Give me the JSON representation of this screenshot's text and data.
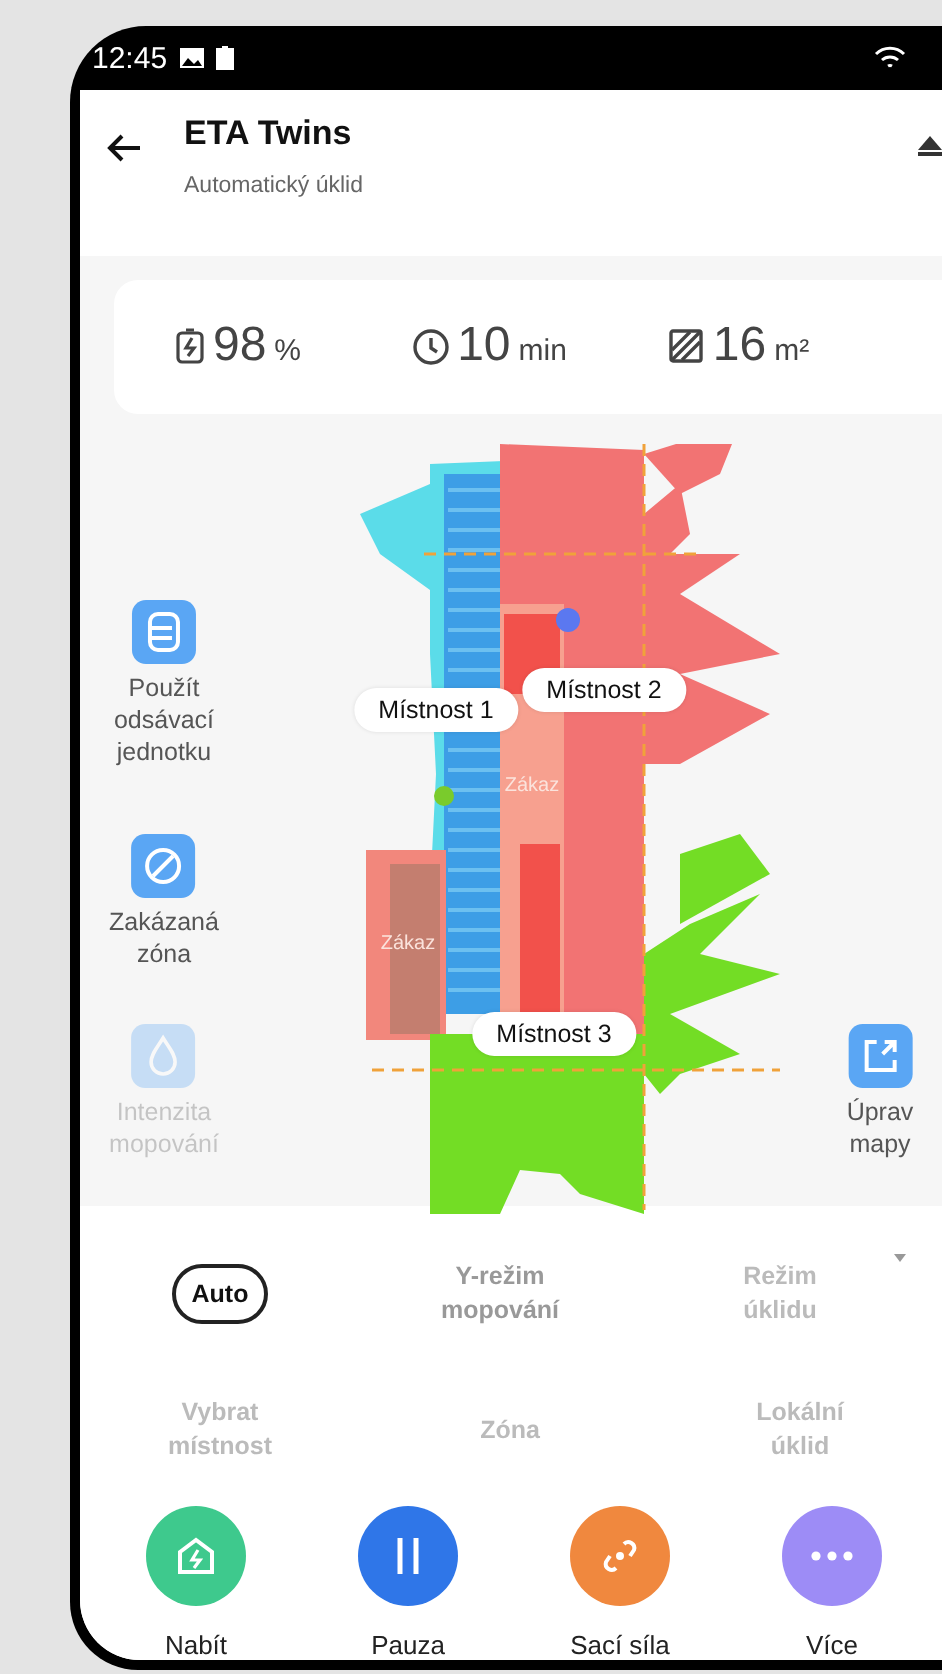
{
  "status_bar": {
    "time": "12:45"
  },
  "header": {
    "title": "ETA Twins",
    "subtitle": "Automatický úklid"
  },
  "stats": [
    {
      "kind": "battery",
      "value": "98",
      "unit": "%"
    },
    {
      "kind": "time",
      "value": "10",
      "unit": "min"
    },
    {
      "kind": "area",
      "value": "16",
      "unit": "m²"
    }
  ],
  "map": {
    "rooms": [
      {
        "label": "Místnost 1"
      },
      {
        "label": "Místnost 2"
      },
      {
        "label": "Místnost 3"
      }
    ],
    "zones": [
      {
        "label": "Zákaz"
      },
      {
        "label": "Zákaz"
      }
    ]
  },
  "side_tools": [
    {
      "kind": "station",
      "label": "Použít\nodsávací\njednotku",
      "disabled": false
    },
    {
      "kind": "nogo",
      "label": "Zakázaná\nzóna",
      "disabled": false
    },
    {
      "kind": "mop",
      "label": "Intenzita\nmopování",
      "disabled": true
    }
  ],
  "edit_tool": {
    "label": "Úprav\nmapy"
  },
  "modes": [
    {
      "label": "Auto",
      "selected": true,
      "disabled": false
    },
    {
      "label": "Y-režim\nmopování",
      "selected": false,
      "disabled": false
    },
    {
      "label": "Režim\núklidu",
      "selected": false,
      "disabled": true
    }
  ],
  "areas": [
    {
      "label": "Vybrat\nmístnost",
      "disabled": true
    },
    {
      "label": "Zóna",
      "disabled": true
    },
    {
      "label": "Lokální\núklid",
      "disabled": true
    }
  ],
  "actions": [
    {
      "kind": "dock",
      "label": "Nabít",
      "color": "#3ec98d"
    },
    {
      "kind": "pause",
      "label": "Pauza",
      "color": "#2f76e8"
    },
    {
      "kind": "suction",
      "label": "Sací síla",
      "color": "#f0883e"
    },
    {
      "kind": "more",
      "label": "Více",
      "color": "#9d8cf6"
    }
  ]
}
